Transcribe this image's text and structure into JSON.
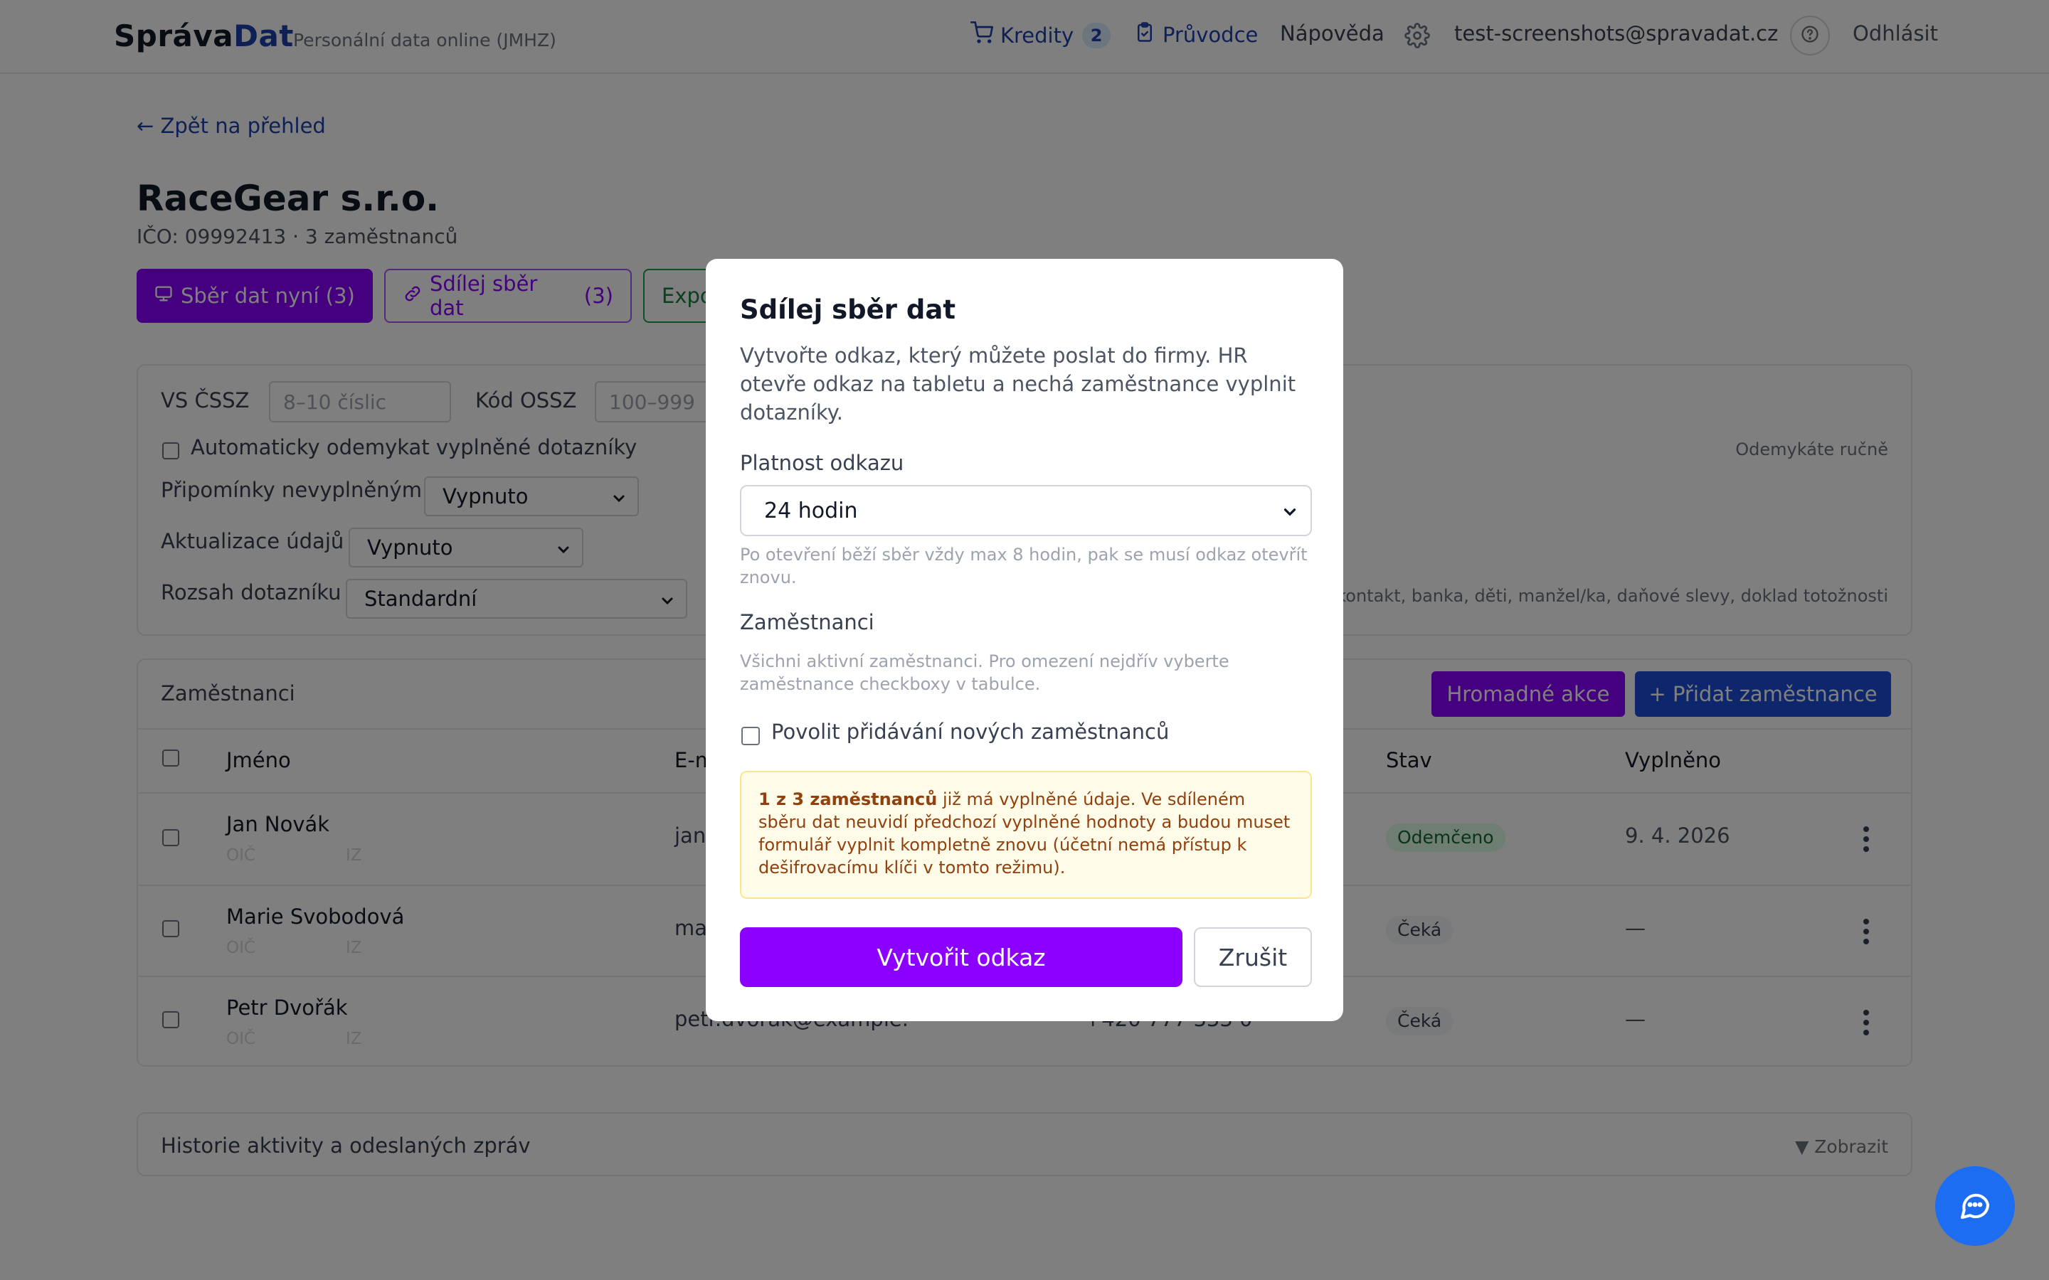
{
  "header": {
    "brand_part1": "Správa",
    "brand_part2": "Dat",
    "tagline": "Personální data online (JMHZ)",
    "credits_label": "Kredity",
    "credits_count": "2",
    "guide_label": "Průvodce",
    "help_label": "Nápověda",
    "user_email": "test-screenshots@spravadat.cz",
    "logout_label": "Odhlásit"
  },
  "page": {
    "back_link": "← Zpět na přehled",
    "company_name": "RaceGear s.r.o.",
    "company_sub": "IČO: 09992413 · 3 zaměstnanců",
    "btn_collect_now": "Sběr dat nyní",
    "btn_collect_now_count": "(3)",
    "btn_share_collect": "Sdílej sběr dat",
    "btn_share_collect_count": "(3)",
    "btn_export": "Expo"
  },
  "settings": {
    "vs_label": "VS ČSSZ",
    "vs_placeholder": "8–10 číslic",
    "ossz_label": "Kód OSSZ",
    "ossz_placeholder": "100–999",
    "auto_unlock_label": "Automaticky odemykat vyplněné dotazníky",
    "manual_unlock_note": "Odemykáte ručně",
    "reminders_label": "Připomínky nevyplněným",
    "reminders_value": "Vypnuto",
    "updates_label": "Aktualizace údajů",
    "updates_value": "Vypnuto",
    "scope_label": "Rozsah dotazníku",
    "scope_value": "Standardní",
    "scope_note": "kontakt, banka, děti, manžel/ka, daňové slevy, doklad totožnosti"
  },
  "employees": {
    "title": "Zaměstnanci",
    "bulk_actions": "Hromadné akce",
    "add_employee": "+ Přidat zaměstnance",
    "columns": {
      "name": "Jméno",
      "email": "E-m",
      "status": "Stav",
      "filled": "Vyplněno"
    },
    "rows": [
      {
        "name": "Jan Novák",
        "oic": "OIČ",
        "iz": "IZ",
        "email": "jan",
        "phone": "",
        "status": "Odemčeno",
        "filled": "9. 4. 2026"
      },
      {
        "name": "Marie Svobodová",
        "oic": "OIČ",
        "iz": "IZ",
        "email": "ma",
        "phone": "",
        "status": "Čeká",
        "filled": "—"
      },
      {
        "name": "Petr Dvořák",
        "oic": "OIČ",
        "iz": "IZ",
        "email": "petr.dvorak@example.",
        "phone": "+420 777 333 0",
        "status": "Čeká",
        "filled": "—"
      }
    ]
  },
  "history": {
    "title": "Historie aktivity a odeslaných zpráv",
    "toggle": "▼ Zobrazit"
  },
  "modal": {
    "title": "Sdílej sběr dat",
    "description": "Vytvořte odkaz, který můžete poslat do firmy. HR otevře odkaz na tabletu a nechá zaměstnance vyplnit dotazníky.",
    "validity_label": "Platnost odkazu",
    "validity_value": "24 hodin",
    "validity_hint": "Po otevření běží sběr vždy max 8 hodin, pak se musí odkaz otevřít znovu.",
    "employees_label": "Zaměstnanci",
    "employees_hint": "Všichni aktivní zaměstnanci. Pro omezení nejdřív vyberte zaměstnance checkboxy v tabulce.",
    "allow_new_label": "Povolit přidávání nových zaměstnanců",
    "warning_bold": "1 z 3 zaměstnanců",
    "warning_text": " již má vyplněné údaje. Ve sdíleném sběru dat neuvidí předchozí vyplněné hodnoty a budou muset formulář vyplnit kompletně znovu (účetní nemá přístup k dešifrovacímu klíči v tomto režimu).",
    "create_button": "Vytvořit odkaz",
    "cancel_button": "Zrušit"
  },
  "colors": {
    "brand_blue": "#1e40af",
    "accent_purple": "#8b00ff",
    "success_green": "#166534",
    "warning_bg": "#fefce8"
  },
  "icons": [
    "cart-icon",
    "clipboard-icon",
    "gear-icon",
    "help-circle-icon",
    "monitor-icon",
    "link-icon",
    "chevron-down-icon",
    "kebab-icon",
    "chat-icon"
  ]
}
